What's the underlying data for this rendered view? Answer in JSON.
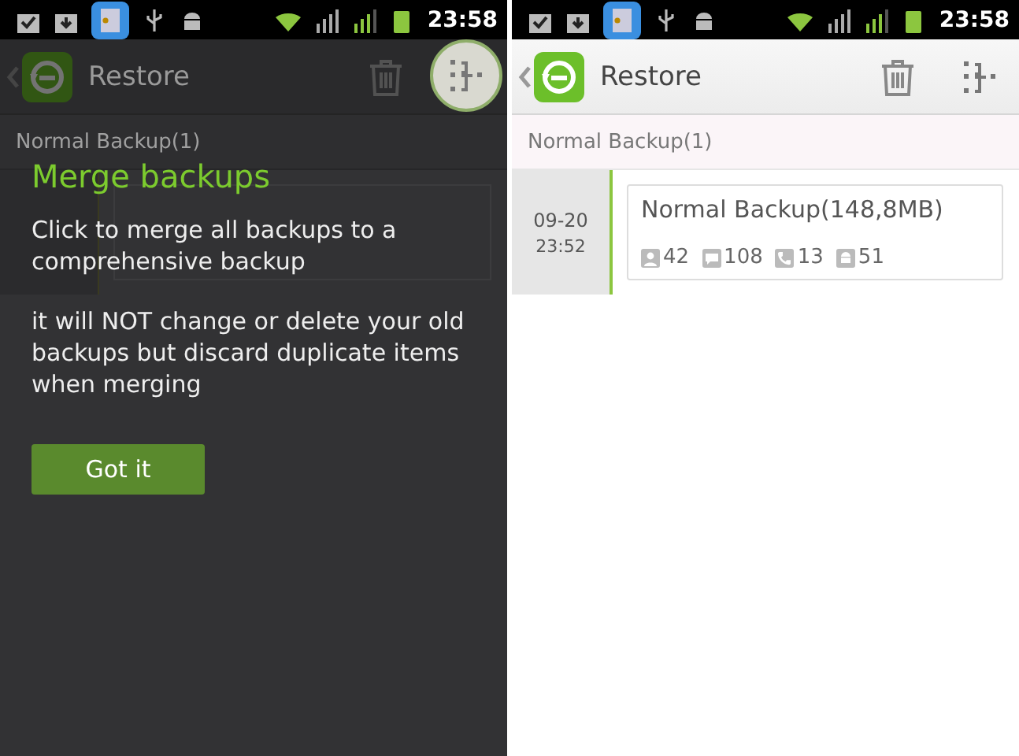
{
  "screens": [
    {
      "dimmed": true,
      "status_bar": {
        "time": "23:58"
      },
      "app_bar": {
        "title": "Restore"
      },
      "section": "Normal Backup(1)",
      "tip": {
        "title": "Merge backups",
        "paragraphs": [
          "Click to merge all backups to a comprehensive backup",
          "it will NOT change or delete your old backups but discard duplicate items when merging"
        ],
        "button": "Got it"
      }
    },
    {
      "dimmed": false,
      "status_bar": {
        "time": "23:58"
      },
      "app_bar": {
        "title": "Restore"
      },
      "section": "Normal Backup(1)",
      "entries": [
        {
          "date": "09-20",
          "time": "23:52",
          "title": "Normal Backup(148,8MB)",
          "counts": [
            {
              "kind": "contacts",
              "value": "42"
            },
            {
              "kind": "messages",
              "value": "108"
            },
            {
              "kind": "calls",
              "value": "13"
            },
            {
              "kind": "apps",
              "value": "51"
            }
          ]
        }
      ]
    }
  ]
}
